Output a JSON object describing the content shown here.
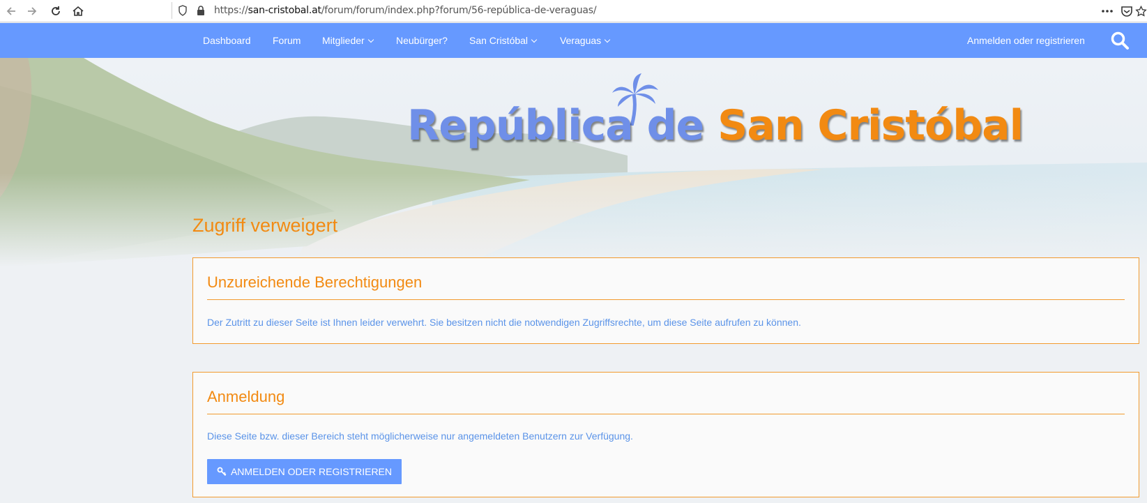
{
  "browser": {
    "url_prefix": "https://",
    "url_host": "san-cristobal.at",
    "url_path": "/forum/forum/index.php?forum/56-república-de-veraguas/"
  },
  "nav": {
    "items": [
      {
        "label": "Dashboard"
      },
      {
        "label": "Forum"
      },
      {
        "label": "Mitglieder"
      },
      {
        "label": "Neubürger?"
      },
      {
        "label": "San Cristóbal"
      },
      {
        "label": "Veraguas"
      }
    ],
    "login_link": "Anmelden oder registrieren"
  },
  "logo": {
    "part1": "República de ",
    "part2": "San Cristóbal"
  },
  "page_title": "Zugriff verweigert",
  "permissions_panel": {
    "heading": "Unzureichende Berechtigungen",
    "message": "Der Zutritt zu dieser Seite ist Ihnen leider verwehrt. Sie besitzen nicht die notwendigen Zugriffsrechte, um diese Seite aufrufen zu können."
  },
  "login_panel": {
    "heading": "Anmeldung",
    "message": "Diese Seite bzw. dieser Bereich steht möglicherweise nur angemeldeten Benutzern zur Verfügung.",
    "button_label": "ANMELDEN ODER REGISTRIEREN"
  },
  "colors": {
    "nav_bg": "#6699ff",
    "accent_orange": "#f28a12",
    "text_blue": "#5a93e8"
  }
}
